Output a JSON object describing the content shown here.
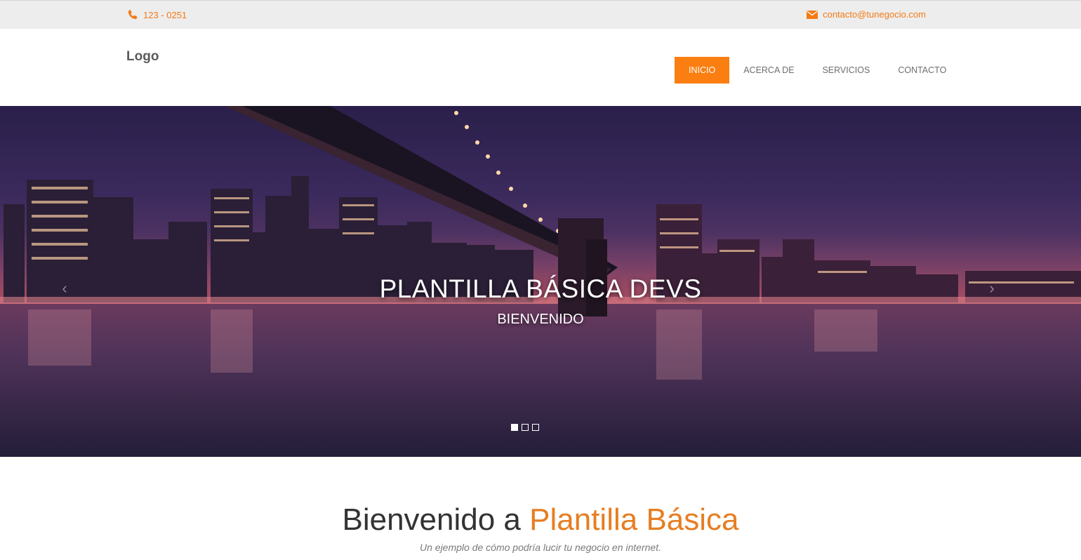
{
  "topbar": {
    "phone": "123 - 0251",
    "email": "contacto@tunegocio.com",
    "phone_icon": "phone-icon",
    "email_icon": "envelope-icon"
  },
  "header": {
    "logo": "Logo",
    "nav": [
      {
        "label": "INICIO",
        "active": true
      },
      {
        "label": "ACERCA DE",
        "active": false
      },
      {
        "label": "SERVICIOS",
        "active": false
      },
      {
        "label": "CONTACTO",
        "active": false
      }
    ]
  },
  "hero": {
    "title": "PLANTILLA BÁSICA DEVS",
    "subtitle": "BIENVENIDO",
    "prev_icon": "chevron-left-icon",
    "next_icon": "chevron-right-icon",
    "slides_count": 3,
    "active_slide": 1
  },
  "welcome": {
    "heading_plain": "Bienvenido a ",
    "heading_accent": "Plantilla Básica",
    "tagline": "Un ejemplo de cómo podría lucir tu negocio en internet."
  },
  "colors": {
    "accent": "#fb7e11",
    "accent_text": "#e67e22",
    "topbar_bg": "#ededed"
  }
}
